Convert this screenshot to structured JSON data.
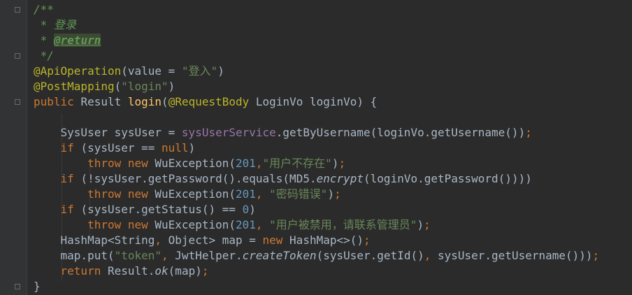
{
  "editor": {
    "language": "java",
    "theme": {
      "background": "#2b2b2b",
      "gutter": "#313335",
      "default_text": "#a9b7c6",
      "keyword": "#cc7832",
      "string": "#6a8759",
      "number": "#6897bb",
      "comment": "#629755",
      "annotation": "#bbb529",
      "method_decl": "#ffc66d",
      "field": "#9876aa"
    }
  },
  "code": {
    "lines": [
      [
        {
          "t": "/**",
          "c": "cm"
        }
      ],
      [
        {
          "t": " * 登录",
          "c": "cm"
        }
      ],
      [
        {
          "t": " * ",
          "c": "cm"
        },
        {
          "t": "@return",
          "c": "tag"
        }
      ],
      [
        {
          "t": " */",
          "c": "cm"
        }
      ],
      [
        {
          "t": "@ApiOperation",
          "c": "ann"
        },
        {
          "t": "(value = ",
          "c": "txt"
        },
        {
          "t": "\"登入\"",
          "c": "str"
        },
        {
          "t": ")",
          "c": "txt"
        }
      ],
      [
        {
          "t": "@PostMapping",
          "c": "ann"
        },
        {
          "t": "(",
          "c": "txt"
        },
        {
          "t": "\"login\"",
          "c": "str"
        },
        {
          "t": ")",
          "c": "txt"
        }
      ],
      [
        {
          "t": "public ",
          "c": "kw"
        },
        {
          "t": "Result ",
          "c": "txt"
        },
        {
          "t": "login",
          "c": "fn"
        },
        {
          "t": "(",
          "c": "txt"
        },
        {
          "t": "@RequestBody",
          "c": "ann"
        },
        {
          "t": " LoginVo loginVo) {",
          "c": "txt"
        }
      ],
      [],
      [
        {
          "t": "    SysUser sysUser = ",
          "c": "txt"
        },
        {
          "t": "sysUserService",
          "c": "fld"
        },
        {
          "t": ".getByUsername(loginVo.getUsername())",
          "c": "txt"
        },
        {
          "t": ";",
          "c": "kw"
        }
      ],
      [
        {
          "t": "    ",
          "c": "txt"
        },
        {
          "t": "if ",
          "c": "kw"
        },
        {
          "t": "(sysUser == ",
          "c": "txt"
        },
        {
          "t": "null",
          "c": "kw"
        },
        {
          "t": ")",
          "c": "txt"
        }
      ],
      [
        {
          "t": "        ",
          "c": "txt"
        },
        {
          "t": "throw new ",
          "c": "kw"
        },
        {
          "t": "WuException(",
          "c": "txt"
        },
        {
          "t": "201",
          "c": "num"
        },
        {
          "t": ",",
          "c": "kw"
        },
        {
          "t": "\"用户不存在\"",
          "c": "str"
        },
        {
          "t": ")",
          "c": "txt"
        },
        {
          "t": ";",
          "c": "kw"
        }
      ],
      [
        {
          "t": "    ",
          "c": "txt"
        },
        {
          "t": "if ",
          "c": "kw"
        },
        {
          "t": "(!sysUser.getPassword().equals(MD5.",
          "c": "txt"
        },
        {
          "t": "encrypt",
          "c": "txt it"
        },
        {
          "t": "(loginVo.getPassword())))",
          "c": "txt"
        }
      ],
      [
        {
          "t": "        ",
          "c": "txt"
        },
        {
          "t": "throw new ",
          "c": "kw"
        },
        {
          "t": "WuException(",
          "c": "txt"
        },
        {
          "t": "201",
          "c": "num"
        },
        {
          "t": ", ",
          "c": "kw"
        },
        {
          "t": "\"密码错误\"",
          "c": "str"
        },
        {
          "t": ")",
          "c": "txt"
        },
        {
          "t": ";",
          "c": "kw"
        }
      ],
      [
        {
          "t": "    ",
          "c": "txt"
        },
        {
          "t": "if ",
          "c": "kw"
        },
        {
          "t": "(sysUser.getStatus() == ",
          "c": "txt"
        },
        {
          "t": "0",
          "c": "num"
        },
        {
          "t": ")",
          "c": "txt"
        }
      ],
      [
        {
          "t": "        ",
          "c": "txt"
        },
        {
          "t": "throw new ",
          "c": "kw"
        },
        {
          "t": "WuException(",
          "c": "txt"
        },
        {
          "t": "201",
          "c": "num"
        },
        {
          "t": ", ",
          "c": "kw"
        },
        {
          "t": "\"用户被禁用，请联系管理员\"",
          "c": "str"
        },
        {
          "t": ")",
          "c": "txt"
        },
        {
          "t": ";",
          "c": "kw"
        }
      ],
      [
        {
          "t": "    HashMap<String",
          "c": "txt"
        },
        {
          "t": ", ",
          "c": "kw"
        },
        {
          "t": "Object> map = ",
          "c": "txt"
        },
        {
          "t": "new ",
          "c": "kw"
        },
        {
          "t": "HashMap<>()",
          "c": "txt"
        },
        {
          "t": ";",
          "c": "kw"
        }
      ],
      [
        {
          "t": "    map.put(",
          "c": "txt"
        },
        {
          "t": "\"token\"",
          "c": "str"
        },
        {
          "t": ", ",
          "c": "kw"
        },
        {
          "t": "JwtHelper.",
          "c": "txt"
        },
        {
          "t": "createToken",
          "c": "txt it"
        },
        {
          "t": "(sysUser.getId()",
          "c": "txt"
        },
        {
          "t": ", ",
          "c": "kw"
        },
        {
          "t": "sysUser.getUsername()))",
          "c": "txt"
        },
        {
          "t": ";",
          "c": "kw"
        }
      ],
      [
        {
          "t": "    ",
          "c": "txt"
        },
        {
          "t": "return ",
          "c": "kw"
        },
        {
          "t": "Result.",
          "c": "txt"
        },
        {
          "t": "ok",
          "c": "txt it"
        },
        {
          "t": "(map)",
          "c": "txt"
        },
        {
          "t": ";",
          "c": "kw"
        }
      ],
      [
        {
          "t": "}",
          "c": "txt"
        }
      ]
    ]
  }
}
